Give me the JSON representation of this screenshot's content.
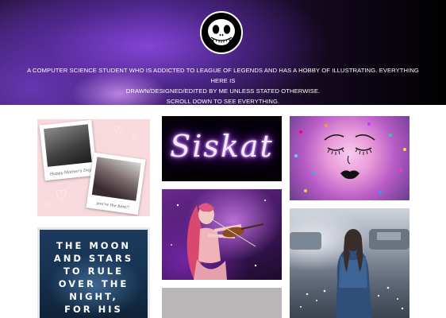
{
  "header": {
    "logo_icon": "jack-skellington-skull-icon",
    "bio_lines": [
      "A COMPUTER SCIENCE STUDENT WHO IS ADDICTED TO LEAGUE OF LEGENDS AND HAS A HOBBY OF ILLUSTRATING. EVERYTHING HERE IS",
      "DRAWN/DESIGNED/EDITED BY ME UNLESS STATED OTHERWISE.",
      "SCROLL DOWN TO SEE EVERYTHING."
    ]
  },
  "gallery": {
    "polaroid_captions": [
      "Happy Mother's Day",
      "you're the best!!"
    ],
    "neon_sign": "Siskat",
    "moon_text": [
      "THE MOON",
      "AND STARS",
      "TO RULE",
      "OVER THE",
      "NIGHT,",
      "FOR HIS"
    ]
  },
  "colors": {
    "header_accent": "#8746dc",
    "neon_glow": "#b45cff",
    "polaroid_bg": "#f7d9de",
    "moon_bg": "#1d3a5e",
    "placeholder_grey": "#bab7b9"
  }
}
